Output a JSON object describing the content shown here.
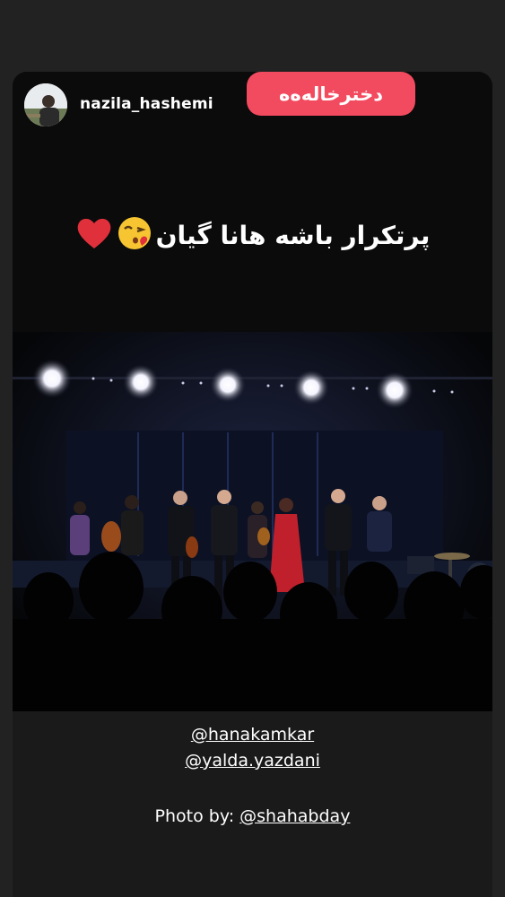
{
  "story": {
    "username": "nazila_hashemi",
    "tag_pill": "دخترخاله‌ه‌ه",
    "caption": "پرتکرار باشه هانا گیان",
    "caption_emojis": [
      "😘",
      "❤️"
    ],
    "mentions": [
      "@hanakamkar",
      "@yalda.yazdani"
    ],
    "photo_credit_prefix": "Photo by: ",
    "photo_credit_handle": "@shahabday"
  },
  "colors": {
    "background": "#222222",
    "pill": "#f24a5e",
    "text": "#ffffff"
  },
  "icons": {
    "avatar": "profile-avatar"
  }
}
